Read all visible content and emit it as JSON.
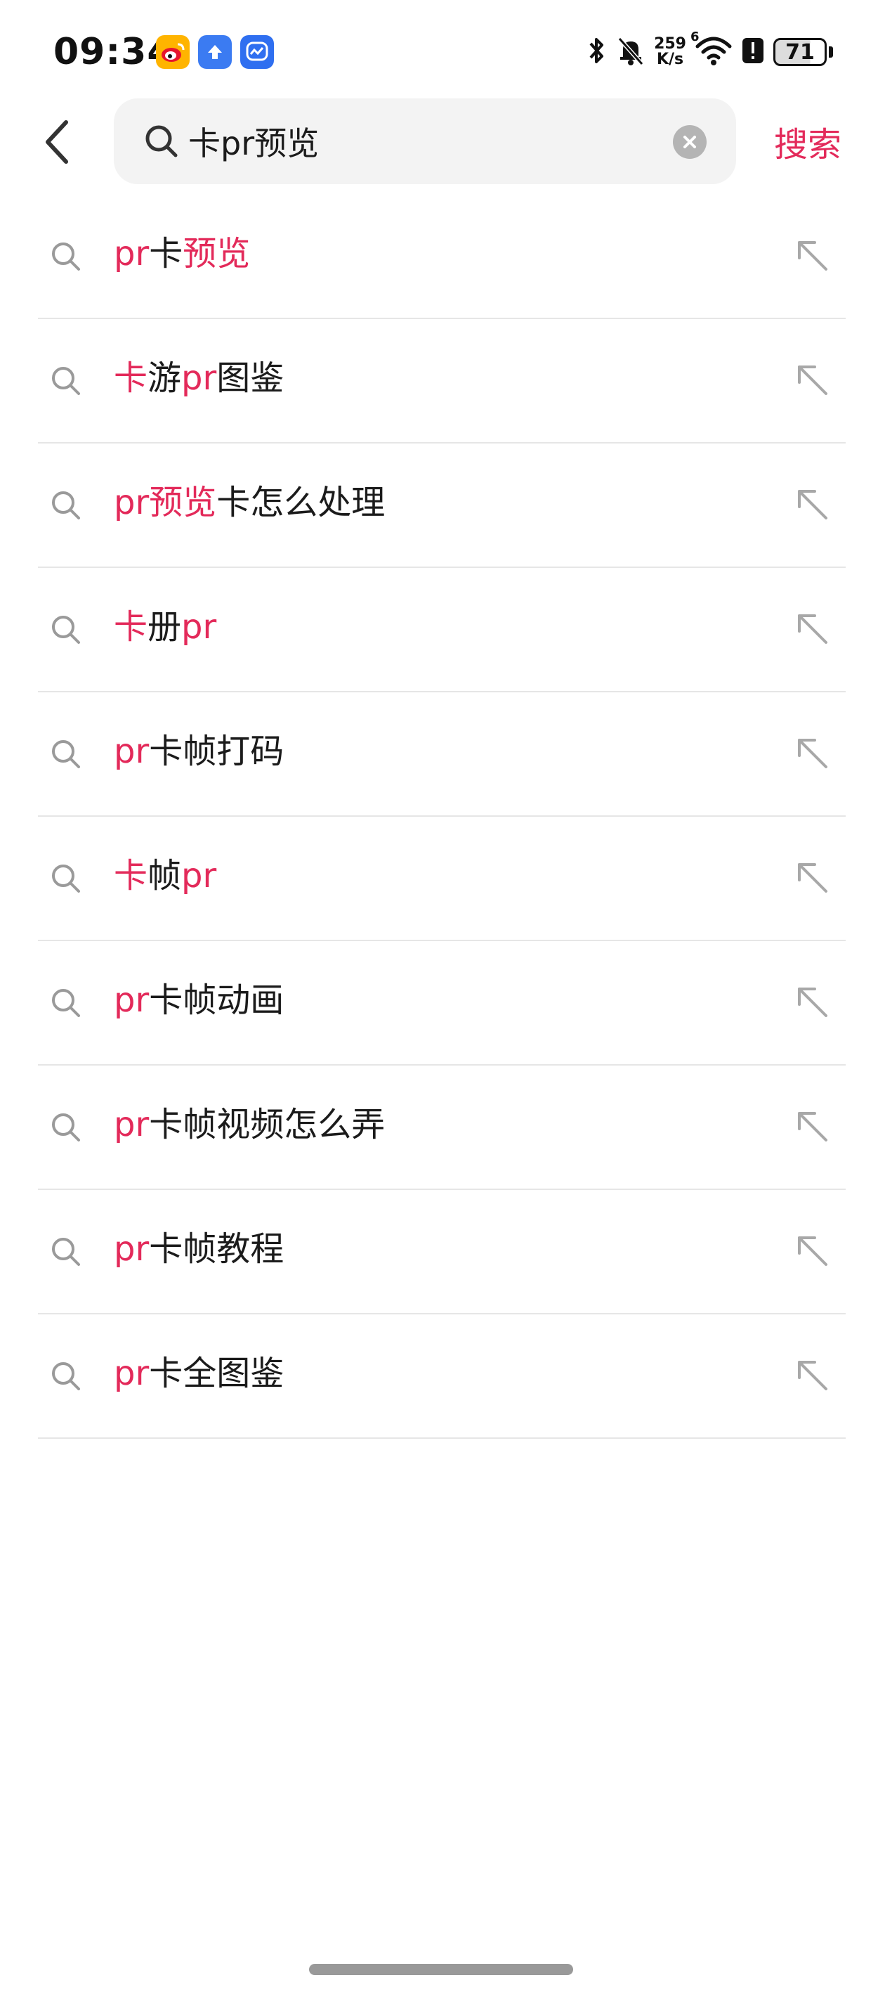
{
  "status_bar": {
    "time": "09:34",
    "net_speed_value": "259",
    "net_speed_unit": "K/s",
    "wifi_generation": "6",
    "battery": "71"
  },
  "header": {
    "search_query": "卡pr预览",
    "submit_label": "搜索"
  },
  "suggestions": [
    {
      "segments": [
        {
          "text": "pr",
          "hl": true
        },
        {
          "text": "卡",
          "hl": false
        },
        {
          "text": "预览",
          "hl": true
        }
      ]
    },
    {
      "segments": [
        {
          "text": "卡",
          "hl": true
        },
        {
          "text": "游",
          "hl": false
        },
        {
          "text": "pr",
          "hl": true
        },
        {
          "text": "图鉴",
          "hl": false
        }
      ]
    },
    {
      "segments": [
        {
          "text": "pr预览",
          "hl": true
        },
        {
          "text": "卡怎么处理",
          "hl": false
        }
      ]
    },
    {
      "segments": [
        {
          "text": "卡",
          "hl": true
        },
        {
          "text": "册",
          "hl": false
        },
        {
          "text": "pr",
          "hl": true
        }
      ]
    },
    {
      "segments": [
        {
          "text": "pr",
          "hl": true
        },
        {
          "text": "卡帧打码",
          "hl": false
        }
      ]
    },
    {
      "segments": [
        {
          "text": "卡",
          "hl": true
        },
        {
          "text": "帧",
          "hl": false
        },
        {
          "text": "pr",
          "hl": true
        }
      ]
    },
    {
      "segments": [
        {
          "text": "pr",
          "hl": true
        },
        {
          "text": "卡帧动画",
          "hl": false
        }
      ]
    },
    {
      "segments": [
        {
          "text": "pr",
          "hl": true
        },
        {
          "text": "卡帧视频怎么弄",
          "hl": false
        }
      ]
    },
    {
      "segments": [
        {
          "text": "pr",
          "hl": true
        },
        {
          "text": "卡帧教程",
          "hl": false
        }
      ]
    },
    {
      "segments": [
        {
          "text": "pr",
          "hl": true
        },
        {
          "text": "卡全图鉴",
          "hl": false
        }
      ]
    }
  ],
  "icons": {
    "status": [
      "weibo-icon",
      "upload-icon",
      "chat-icon",
      "bluetooth-icon",
      "mute-bell-icon",
      "wifi-icon",
      "alert-icon",
      "battery-icon"
    ],
    "header": [
      "back-arrow-icon",
      "search-icon",
      "clear-icon"
    ],
    "row": [
      "search-icon",
      "fill-arrow-icon"
    ]
  },
  "colors": {
    "accent": "#e32a5a",
    "text": "#1b1b1b",
    "icon_gray": "#9a9a9a",
    "search_bg": "#f3f3f3",
    "divider": "#e6e6e6"
  }
}
